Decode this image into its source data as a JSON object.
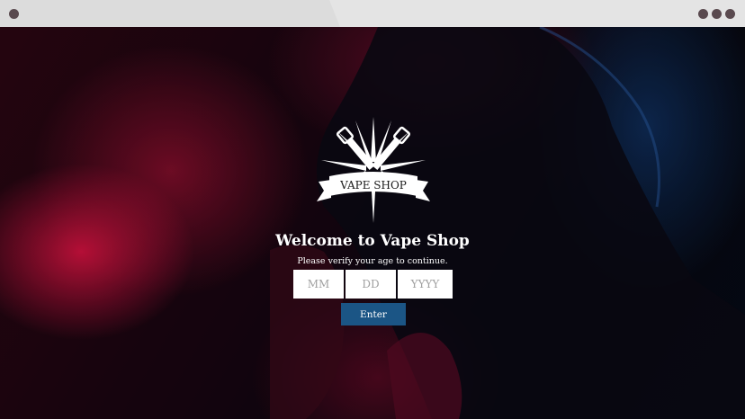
{
  "logo": {
    "label": "VAPE SHOP",
    "icon": "vape-shop-logo"
  },
  "modal": {
    "title": "Welcome to Vape Shop",
    "subtitle": "Please verify your age to continue.",
    "month_placeholder": "MM",
    "day_placeholder": "DD",
    "year_placeholder": "YYYY",
    "enter_label": "Enter"
  },
  "colors": {
    "button": "#1b5585",
    "chrome": "#dcdcdc",
    "window_dot": "#5a4a4f"
  }
}
